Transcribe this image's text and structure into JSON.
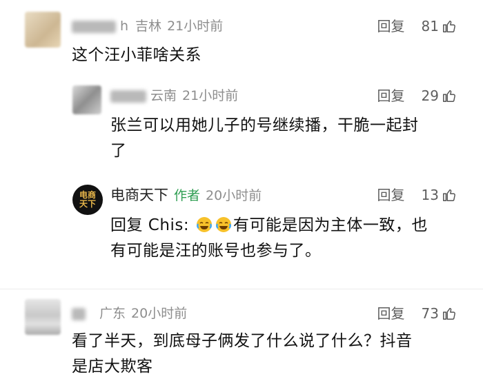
{
  "comments": [
    {
      "region": "吉林",
      "name_tail": "h",
      "time": "21小时前",
      "reply_label": "回复",
      "likes": "81",
      "text": "这个汪小菲啥关系"
    },
    {
      "region": "云南",
      "time": "21小时前",
      "reply_label": "回复",
      "likes": "29",
      "text_line1": "张兰可以用她儿子的号继续播，干脆一起封",
      "text_line2": "了"
    },
    {
      "author": "电商天下",
      "author_tag": "作者",
      "avatar_text": "电商天下",
      "time": "20小时前",
      "reply_label": "回复",
      "likes": "13",
      "reply_prefix": "回复 Chis:",
      "text_line1_rest": "有可能是因为主体一致，也",
      "text_line2": "有可能是汪的账号也参与了。"
    },
    {
      "region": "广东",
      "time": "20小时前",
      "reply_label": "回复",
      "likes": "73",
      "text_line1": "看了半天，到底母子俩发了什么说了什么？抖音",
      "text_line2": "是店大欺客"
    }
  ],
  "colors": {
    "meta_gray": "#8d8d8d",
    "author_tag_green": "#2f9e52",
    "author_avatar_bg": "#111111",
    "author_avatar_text": "#e7b64a",
    "emoji_yellow": "#f7c12a"
  }
}
